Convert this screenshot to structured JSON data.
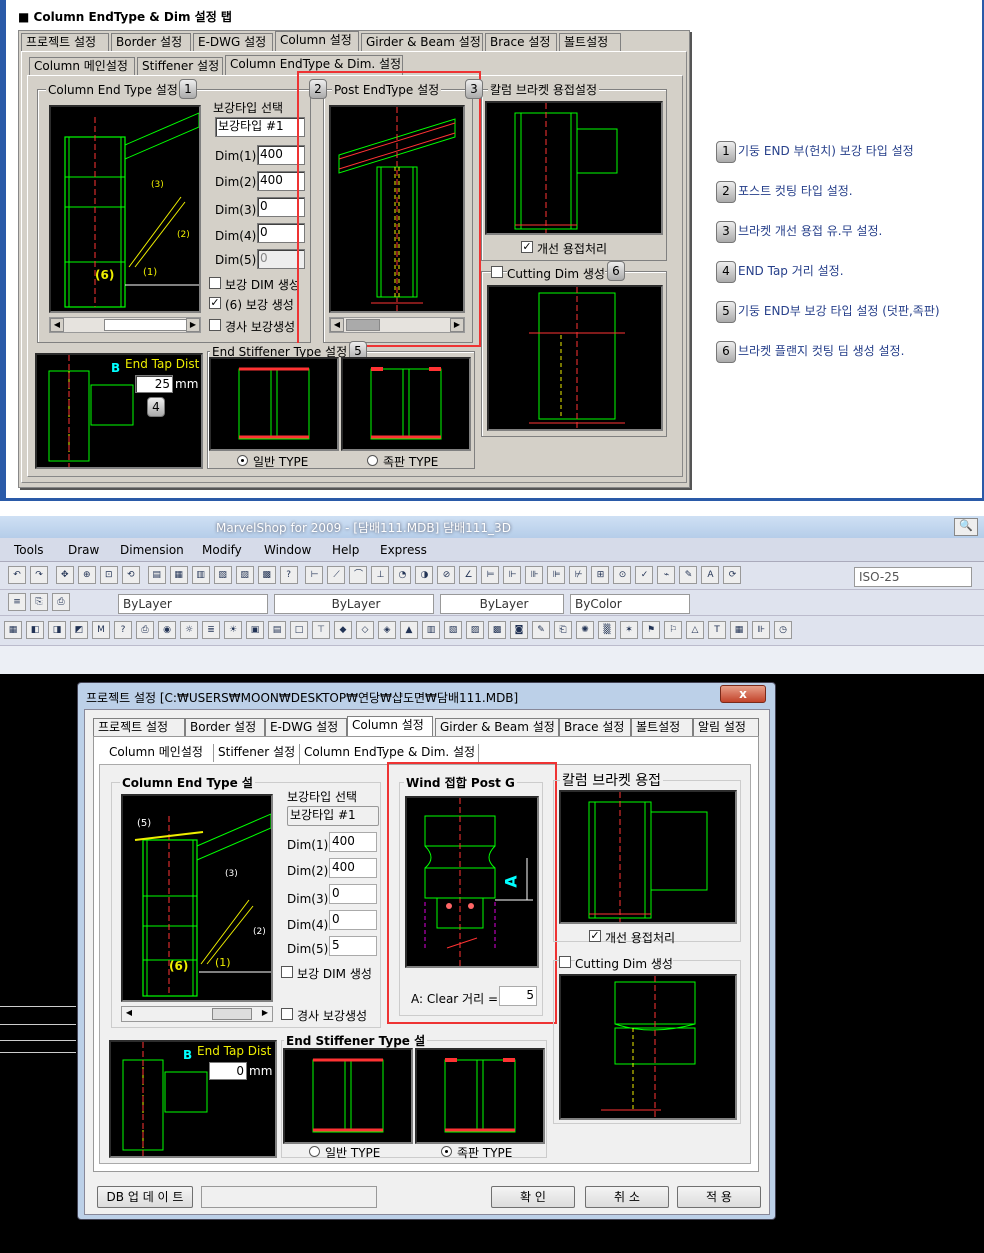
{
  "top": {
    "title": "■ Column EndType & Dim 설정 탭",
    "tabs": [
      "프로젝트 설정",
      "Border 설정",
      "E-DWG 설정",
      "Column 설정",
      "Girder & Beam 설정",
      "Brace 설정",
      "볼트설정"
    ],
    "subtabs": [
      "Column 메인설정",
      "Stiffener 설정",
      "Column EndType & Dim. 설정"
    ],
    "group1_title": "Column End Type 설정",
    "group2_title": "Post EndType 설정",
    "group3_title": "칼럼 브라켓 용접설정",
    "group5_title": "End Stiffener Type 설정",
    "group6_title": "Cutting Dim 생성",
    "reinforce_label": "보강타입 선택",
    "reinforce_value": "보강타입 #1",
    "dims": [
      {
        "label": "Dim(1)",
        "value": "400"
      },
      {
        "label": "Dim(2)",
        "value": "400"
      },
      {
        "label": "Dim(3)",
        "value": "0"
      },
      {
        "label": "Dim(4)",
        "value": "0"
      },
      {
        "label": "Dim(5)",
        "value": "0"
      }
    ],
    "chk_dim": "보강 DIM 생성",
    "chk_6": "(6) 보강 생성",
    "chk_slope": "경사 보강생성",
    "chk_weld": "개선 용접처리",
    "end_tap_label": "End Tap Dist",
    "end_tap_value": "25",
    "mm": "mm",
    "b_label": "B",
    "radio_normal": "일반 TYPE",
    "radio_side": "족판 TYPE",
    "badges": [
      "1",
      "2",
      "3",
      "4",
      "5",
      "6"
    ],
    "dim_marks": [
      "(3)",
      "(2)",
      "(1)",
      "(6)"
    ]
  },
  "legend": [
    {
      "num": "1",
      "text": "기둥 END 부(헌치) 보강 타입 설정"
    },
    {
      "num": "2",
      "text": "포스트 컷팅 타입 설정."
    },
    {
      "num": "3",
      "text": "브라켓 개선 용접 유.무 설정."
    },
    {
      "num": "4",
      "text": "END Tap 거리 설정."
    },
    {
      "num": "5",
      "text": "기둥 END부 보강 타입 설정 (덧판,족판)"
    },
    {
      "num": "6",
      "text": "브라켓 플랜지 컷팅 딤 생성 설정."
    }
  ],
  "cad": {
    "title": "MarvelShop for 2009 - [담배111.MDB] 담배111_3D",
    "menu": [
      "Tools",
      "Draw",
      "Dimension",
      "Modify",
      "Window",
      "Help",
      "Express"
    ],
    "iso": "ISO-25",
    "bylayer1": "ByLayer",
    "bylayer2": "ByLayer",
    "bylayer3": "ByLayer",
    "bycolor": "ByColor"
  },
  "dialog": {
    "title": "프로젝트 설정  [C:₩USERS₩MOON₩DESKTOP₩연당₩샵도면₩담배111.MDB]",
    "close": "x",
    "tabs": [
      "프로젝트 설정",
      "Border 설정",
      "E-DWG 설정",
      "Column 설정",
      "Girder & Beam 설정",
      "Brace 설정",
      "볼트설정",
      "알림 설정"
    ],
    "subtabs": [
      "Column 메인설정",
      "Stiffener 설정",
      "Column EndType & Dim. 설정"
    ],
    "group1_title": "Column End Type 설",
    "group2_title": "Wind 접합 Post G",
    "group3_title": "칼럼 브라켓 용접",
    "group5_title": "End Stiffener Type 설",
    "group6_title": "Cutting Dim 생성",
    "reinforce_label": "보강타입 선택",
    "reinforce_value": "보강타입 #1",
    "dims": [
      {
        "label": "Dim(1)",
        "value": "400"
      },
      {
        "label": "Dim(2)",
        "value": "400"
      },
      {
        "label": "Dim(3)",
        "value": "0"
      },
      {
        "label": "Dim(4)",
        "value": "0"
      },
      {
        "label": "Dim(5)",
        "value": "5"
      }
    ],
    "chk_dim": "보강 DIM 생성",
    "chk_slope": "경사 보강생성",
    "chk_weld": "개선 용접처리",
    "clear_label": "A: Clear 거리 =",
    "clear_value": "5",
    "a_mark": "A",
    "end_tap_label": "End Tap Dist",
    "end_tap_value": "0",
    "mm": "mm",
    "b_label": "B",
    "radio_normal": "일반 TYPE",
    "radio_side": "족판 TYPE",
    "db_button": "DB 업 데 이 트",
    "ok": "확    인",
    "cancel": "취    소",
    "apply": "적    용",
    "dim_marks": [
      "(5)",
      "(3)",
      "(2)",
      "(1)",
      "(6)"
    ]
  }
}
